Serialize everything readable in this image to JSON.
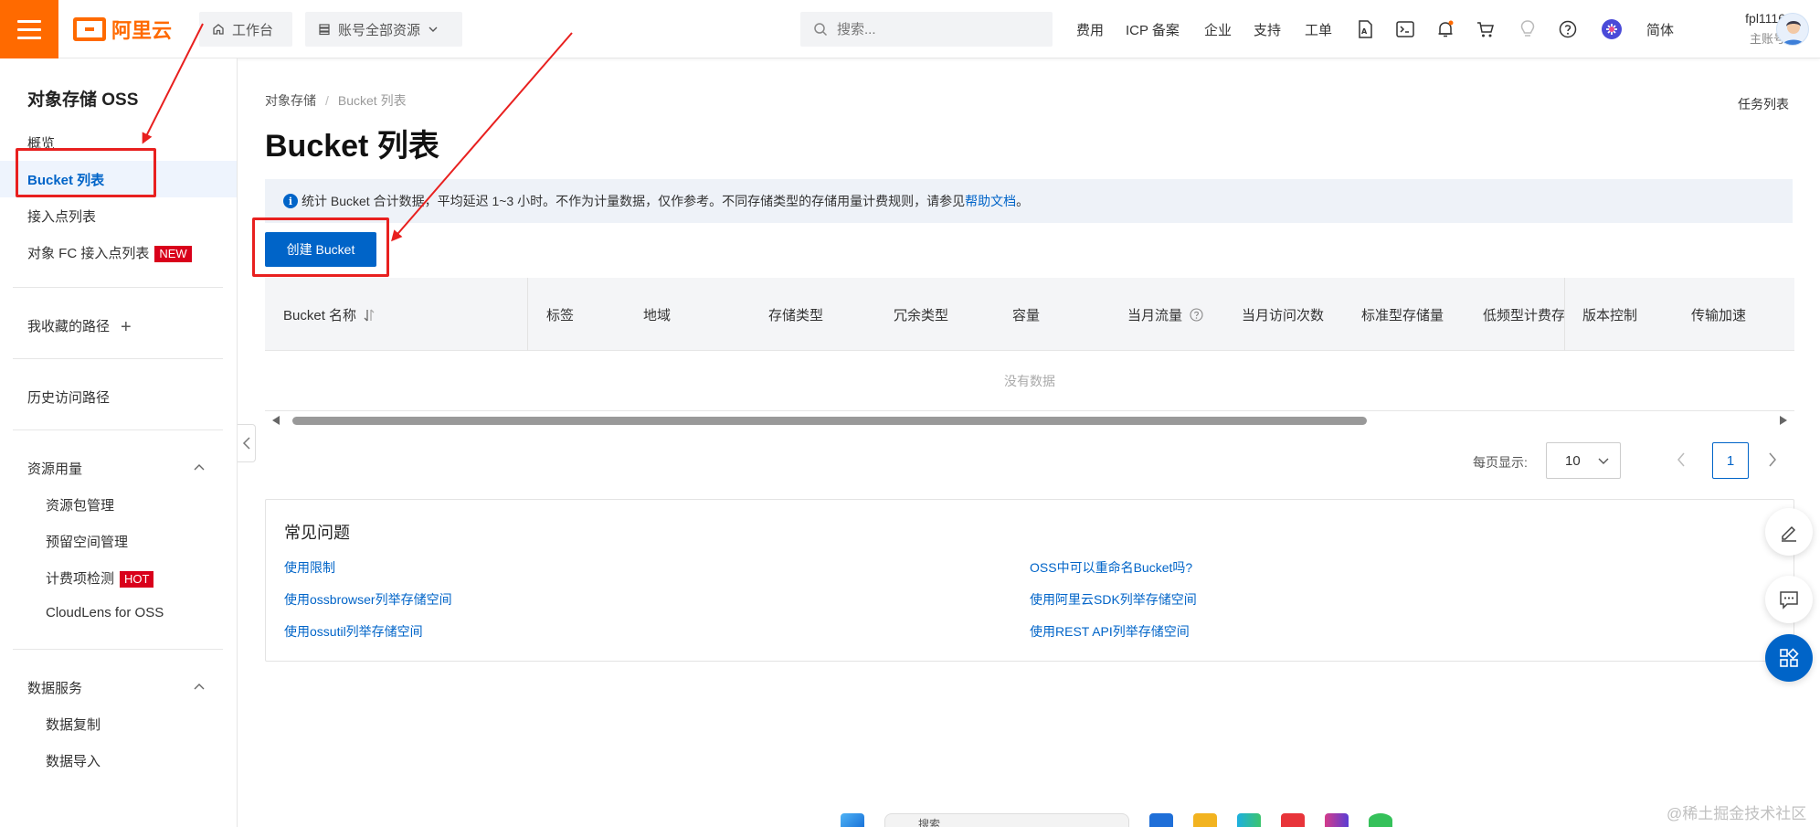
{
  "topbar": {
    "logo_text": "阿里云",
    "workbench": "工作台",
    "resources": "账号全部资源",
    "search_placeholder": "搜索...",
    "nav": [
      "费用",
      "ICP 备案",
      "企业",
      "支持",
      "工单"
    ],
    "language": "简体",
    "user_name": "fpl1116",
    "user_role": "主账号"
  },
  "sidebar": {
    "title": "对象存储 OSS",
    "overview": "概览",
    "bucket_list": "Bucket 列表",
    "access_points": "接入点列表",
    "fc_access_points": "对象 FC 接入点列表",
    "new_badge": "NEW",
    "favorites": "我收藏的路径",
    "history": "历史访问路径",
    "resource_usage": "资源用量",
    "resource_pkg": "资源包管理",
    "reserved_space": "预留空间管理",
    "billing_check": "计费项检测",
    "hot_badge": "HOT",
    "cloudlens": "CloudLens for OSS",
    "data_service": "数据服务",
    "data_replication": "数据复制",
    "data_import": "数据导入"
  },
  "main": {
    "breadcrumb_root": "对象存储",
    "breadcrumb_current": "Bucket 列表",
    "task_list": "任务列表",
    "title": "Bucket 列表",
    "info_text": "统计 Bucket 合计数据，平均延迟 1~3 小时。不作为计量数据，仅作参考。不同存储类型的存储用量计费规则，请参见",
    "info_link": "帮助文档",
    "info_end": "。",
    "create_button": "创建 Bucket",
    "columns": [
      "Bucket 名称",
      "标签",
      "地域",
      "存储类型",
      "冗余类型",
      "容量",
      "当月流量",
      "当月访问次数",
      "标准型存储量",
      "低频型计费存",
      "版本控制",
      "传输加速"
    ],
    "empty_text": "没有数据",
    "page_size_label": "每页显示:",
    "page_size": "10",
    "current_page": "1"
  },
  "faq": {
    "title": "常见问题",
    "links_left": [
      "使用限制",
      "使用ossbrowser列举存储空间",
      "使用ossutil列举存储空间"
    ],
    "links_right": [
      "OSS中可以重命名Bucket吗?",
      "使用阿里云SDK列举存储空间",
      "使用REST API列举存储空间"
    ]
  },
  "taskbar": {
    "search": "搜索"
  },
  "watermark": "@稀土掘金技术社区",
  "colors": {
    "brand_orange": "#ff6a00",
    "primary_blue": "#0064c8",
    "annotation_red": "#e8201f",
    "badge_red": "#d9001b"
  }
}
